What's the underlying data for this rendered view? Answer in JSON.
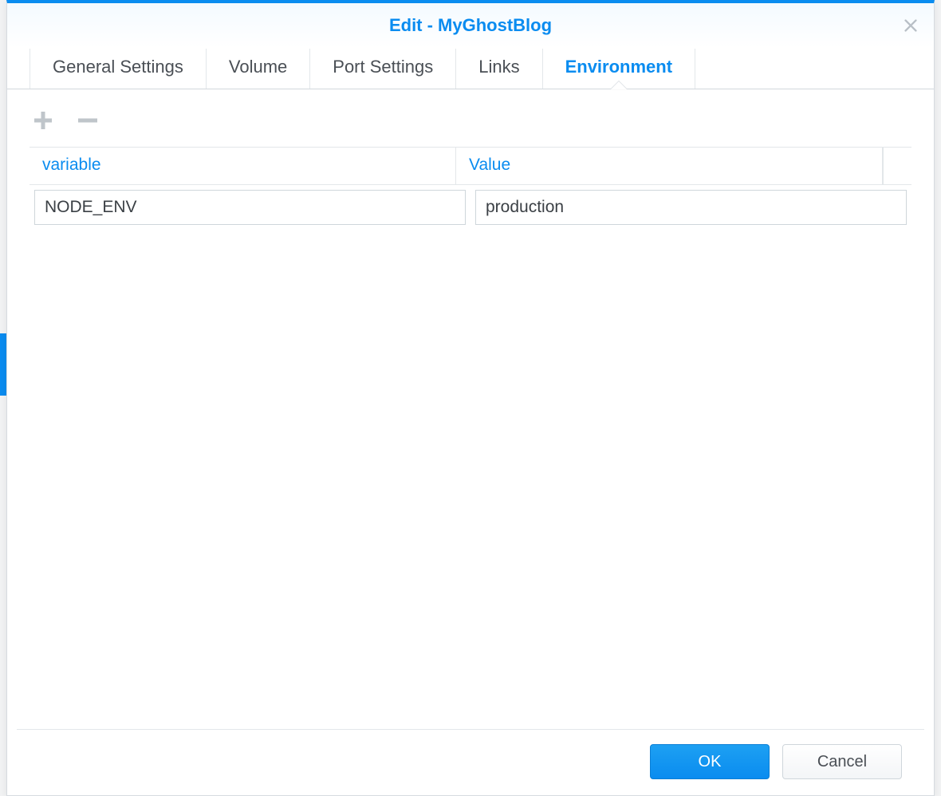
{
  "dialog": {
    "title": "Edit - MyGhostBlog"
  },
  "tabs": {
    "general": "General Settings",
    "volume": "Volume",
    "port": "Port Settings",
    "links": "Links",
    "environment": "Environment"
  },
  "grid": {
    "headers": {
      "variable": "variable",
      "value": "Value"
    },
    "rows": [
      {
        "variable": "NODE_ENV",
        "value": "production"
      }
    ]
  },
  "footer": {
    "ok": "OK",
    "cancel": "Cancel"
  }
}
